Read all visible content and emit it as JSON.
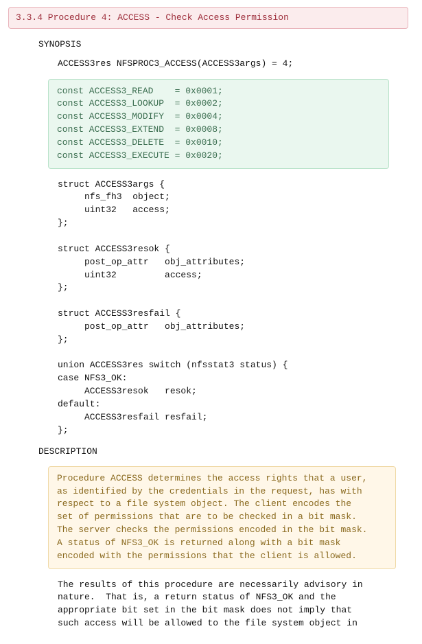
{
  "heading": "3.3.4 Procedure 4: ACCESS - Check Access Permission",
  "synopsis_label": "SYNOPSIS",
  "synopsis_line": "ACCESS3res NFSPROC3_ACCESS(ACCESS3args) = 4;",
  "const_block": "const ACCESS3_READ    = 0x0001;\nconst ACCESS3_LOOKUP  = 0x0002;\nconst ACCESS3_MODIFY  = 0x0004;\nconst ACCESS3_EXTEND  = 0x0008;\nconst ACCESS3_DELETE  = 0x0010;\nconst ACCESS3_EXECUTE = 0x0020;",
  "code_block": "struct ACCESS3args {\n     nfs_fh3  object;\n     uint32   access;\n};\n\nstruct ACCESS3resok {\n     post_op_attr   obj_attributes;\n     uint32         access;\n};\n\nstruct ACCESS3resfail {\n     post_op_attr   obj_attributes;\n};\n\nunion ACCESS3res switch (nfsstat3 status) {\ncase NFS3_OK:\n     ACCESS3resok   resok;\ndefault:\n     ACCESS3resfail resfail;\n};",
  "description_label": "DESCRIPTION",
  "description_box": "Procedure ACCESS determines the access rights that a user,\nas identified by the credentials in the request, has with\nrespect to a file system object. The client encodes the\nset of permissions that are to be checked in a bit mask.\nThe server checks the permissions encoded in the bit mask.\nA status of NFS3_OK is returned along with a bit mask\nencoded with the permissions that the client is allowed.",
  "body_paragraph": "The results of this procedure are necessarily advisory in\nnature.  That is, a return status of NFS3_OK and the\nappropriate bit set in the bit mask does not imply that\nsuch access will be allowed to the file system object in"
}
